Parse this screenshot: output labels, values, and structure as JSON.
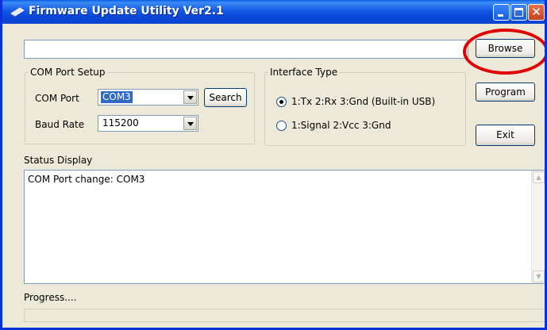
{
  "window": {
    "title": "Firmware Update Utility Ver2.1"
  },
  "file": {
    "path_value": "",
    "browse_label": "Browse"
  },
  "com_setup": {
    "legend": "COM Port Setup",
    "port_label": "COM Port",
    "port_value": "COM3",
    "search_label": "Search",
    "baud_label": "Baud Rate",
    "baud_value": "115200"
  },
  "interface": {
    "legend": "Interface Type",
    "options": [
      {
        "label": "1:Tx 2:Rx 3:Gnd (Built-in USB)",
        "checked": true
      },
      {
        "label": "1:Signal 2:Vcc 3:Gnd",
        "checked": false
      }
    ]
  },
  "actions": {
    "program_label": "Program",
    "exit_label": "Exit"
  },
  "status": {
    "label": "Status Display",
    "text": "COM Port change: COM3"
  },
  "progress": {
    "label": "Progress....",
    "percent": 0
  },
  "colors": {
    "titlebar": "#0a47d6",
    "highlight": "#e00000",
    "selection": "#316ac5"
  }
}
